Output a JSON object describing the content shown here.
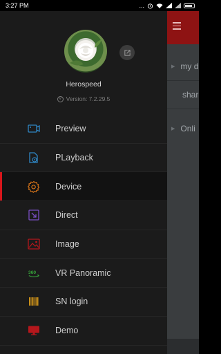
{
  "status_bar": {
    "time": "3:27 PM",
    "dots": "..."
  },
  "profile": {
    "username": "Herospeed",
    "version": "Version: 7.2.29.5"
  },
  "menu": [
    {
      "label": "Preview",
      "icon": "preview-camera-icon",
      "color": "#2f86c4"
    },
    {
      "label": "PLayback",
      "icon": "playback-icon",
      "color": "#2f86c4"
    },
    {
      "label": "Device",
      "icon": "gear-icon",
      "color": "#e0791a",
      "active": true
    },
    {
      "label": "Direct",
      "icon": "direct-icon",
      "color": "#7a4fc2"
    },
    {
      "label": "Image",
      "icon": "image-icon",
      "color": "#b5171c"
    },
    {
      "label": "VR Panoramic",
      "icon": "360-icon",
      "color": "#36a33a"
    },
    {
      "label": "SN login",
      "icon": "barcode-icon",
      "color": "#d99a19"
    },
    {
      "label": "Demo",
      "icon": "monitor-icon",
      "color": "#b5171c"
    }
  ],
  "background_app": {
    "rows": [
      {
        "text": "my d",
        "arrow": true
      },
      {
        "text": "shar",
        "arrow": false
      },
      {
        "text": "Onli",
        "arrow": true
      }
    ]
  }
}
